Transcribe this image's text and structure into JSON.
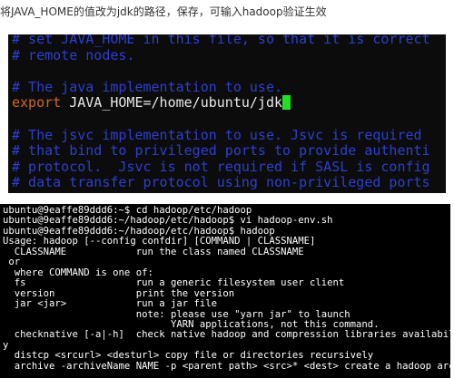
{
  "caption": "将JAVA_HOME的值改为jdk的路径，保存，可输入hadoop验证生效",
  "vim": {
    "lines": [
      {
        "kind": "comment",
        "text": "# set JAVA_HOME in this file, so that it is correct"
      },
      {
        "kind": "comment",
        "text": "# remote nodes."
      },
      {
        "kind": "comment",
        "text": ""
      },
      {
        "kind": "comment",
        "text": "# The java implementation to use."
      },
      {
        "kind": "export",
        "keyword": "export",
        "value": " JAVA_HOME=/home/ubuntu/jdk"
      },
      {
        "kind": "comment",
        "text": ""
      },
      {
        "kind": "comment",
        "text": "# The jsvc implementation to use. Jsvc is required"
      },
      {
        "kind": "comment",
        "text": "# that bind to privileged ports to provide authenti"
      },
      {
        "kind": "comment",
        "text": "# protocol.  Jsvc is not required if SASL is config"
      },
      {
        "kind": "comment",
        "text": "# data transfer protocol using non-privileged ports"
      }
    ],
    "colors": {
      "comment": "#2f3fcf",
      "keyword": "#d2691e",
      "cursor": "#22e022"
    }
  },
  "terminal": {
    "lines": [
      "ubuntu@9eaffe89ddd6:~$ cd hadoop/etc/hadoop",
      "ubuntu@9eaffe89ddd6:~/hadoop/etc/hadoop$ vi hadoop-env.sh",
      "ubuntu@9eaffe89ddd6:~/hadoop/etc/hadoop$ hadoop",
      "Usage: hadoop [--config confdir] [COMMAND | CLASSNAME]",
      "  CLASSNAME            run the class named CLASSNAME",
      " or",
      "  where COMMAND is one of:",
      "  fs                   run a generic filesystem user client",
      "  version              print the version",
      "  jar <jar>            run a jar file",
      "                       note: please use \"yarn jar\" to launch",
      "                             YARN applications, not this command.",
      "  checknative [-a|-h]  check native hadoop and compression libraries availabilit",
      "y",
      "  distcp <srcurl> <desturl> copy file or directories recursively",
      "  archive -archiveName NAME -p <parent path> <src>* <dest> create a hadoop archi"
    ]
  }
}
